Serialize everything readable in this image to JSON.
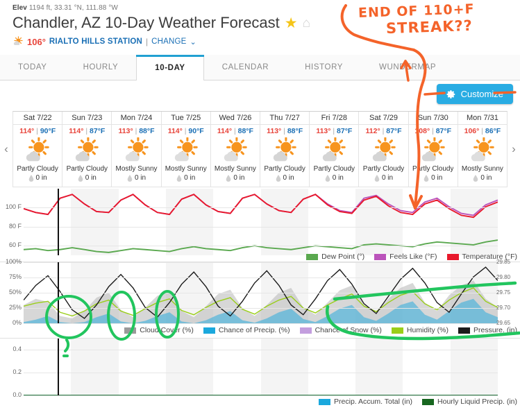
{
  "header": {
    "elev_prefix": "Elev",
    "elev_value": "1194 ft, 33.31 °N, 111.88 °W",
    "title": "Chandler, AZ 10-Day Weather Forecast",
    "star_icon": "star-icon",
    "home_icon": "home-icon",
    "current_temp": "106°",
    "station": "RIALTO HILLS STATION",
    "pipe": "|",
    "change_label": "CHANGE",
    "chevron": "chevron-down-icon"
  },
  "tabs": [
    {
      "label": "TODAY",
      "active": false
    },
    {
      "label": "HOURLY",
      "active": false
    },
    {
      "label": "10-DAY",
      "active": true
    },
    {
      "label": "CALENDAR",
      "active": false
    },
    {
      "label": "HISTORY",
      "active": false
    },
    {
      "label": "WUNDERMAP",
      "active": false
    }
  ],
  "customize": {
    "label": "Customize",
    "icon": "gear-icon",
    "color": "#29ace3"
  },
  "nav": {
    "prev": "‹",
    "next": "›"
  },
  "days": [
    {
      "name": "Sat 7/22",
      "high": "114°",
      "low": "90°F",
      "cond": "Partly Cloudy",
      "precip": "0 in",
      "icon": "partly-cloudy-icon"
    },
    {
      "name": "Sun 7/23",
      "high": "114°",
      "low": "87°F",
      "cond": "Partly Cloudy",
      "precip": "0 in",
      "icon": "partly-cloudy-icon"
    },
    {
      "name": "Mon 7/24",
      "high": "113°",
      "low": "88°F",
      "cond": "Mostly Sunny",
      "precip": "0 in",
      "icon": "mostly-sunny-icon"
    },
    {
      "name": "Tue 7/25",
      "high": "114°",
      "low": "90°F",
      "cond": "Mostly Sunny",
      "precip": "0 in",
      "icon": "mostly-sunny-icon"
    },
    {
      "name": "Wed 7/26",
      "high": "114°",
      "low": "88°F",
      "cond": "Mostly Sunny",
      "precip": "0 in",
      "icon": "mostly-sunny-icon"
    },
    {
      "name": "Thu 7/27",
      "high": "113°",
      "low": "88°F",
      "cond": "Partly Cloudy",
      "precip": "0 in",
      "icon": "partly-cloudy-icon"
    },
    {
      "name": "Fri 7/28",
      "high": "113°",
      "low": "87°F",
      "cond": "Partly Cloudy",
      "precip": "0 in",
      "icon": "partly-cloudy-icon"
    },
    {
      "name": "Sat 7/29",
      "high": "112°",
      "low": "87°F",
      "cond": "Partly Cloudy",
      "precip": "0 in",
      "icon": "partly-cloudy-icon"
    },
    {
      "name": "Sun 7/30",
      "high": "108°",
      "low": "87°F",
      "cond": "Partly Cloudy",
      "precip": "0 in",
      "icon": "partly-cloudy-icon"
    },
    {
      "name": "Mon 7/31",
      "high": "106°",
      "low": "86°F",
      "cond": "Mostly Sunny",
      "precip": "0 in",
      "icon": "mostly-sunny-icon"
    }
  ],
  "annotations": {
    "orange_line1": "END OF 110+F",
    "orange_line2": "STREAK??",
    "orange_color": "#f4632a",
    "green_color": "#22c55e",
    "green_question": "?"
  },
  "chart_data": [
    {
      "type": "line",
      "title": "Temperature / Feels Like / Dew Point",
      "xlabel": "",
      "ylabel": "",
      "ylim": [
        50,
        120
      ],
      "yticks": [
        "60 F",
        "80 F",
        "100 F"
      ],
      "ytick_values": [
        60,
        80,
        100
      ],
      "grid": true,
      "legend_position": "bottom-right",
      "categories": [
        "Sat 7/22",
        "Sun 7/23",
        "Mon 7/24",
        "Tue 7/25",
        "Wed 7/26",
        "Thu 7/27",
        "Fri 7/28",
        "Sat 7/29",
        "Sun 7/30",
        "Mon 7/31"
      ],
      "series": [
        {
          "name": "Temperature (°F)",
          "color": "#e8192c",
          "values": [
            99,
            95,
            93,
            110,
            114,
            104,
            96,
            95,
            108,
            114,
            103,
            95,
            93,
            109,
            114,
            103,
            96,
            94,
            110,
            114,
            104,
            97,
            95,
            109,
            114,
            103,
            96,
            94,
            108,
            112,
            102,
            95,
            93,
            104,
            108,
            99,
            92,
            90,
            101,
            106
          ]
        },
        {
          "name": "Feels Like (°F)",
          "color": "#bb54bb",
          "values": [
            99,
            95,
            93,
            110,
            114,
            104,
            96,
            95,
            108,
            114,
            103,
            95,
            93,
            109,
            114,
            103,
            96,
            94,
            110,
            114,
            104,
            97,
            95,
            109,
            114,
            104,
            97,
            95,
            110,
            113,
            104,
            97,
            95,
            106,
            110,
            101,
            94,
            92,
            103,
            108
          ]
        },
        {
          "name": "Dew Point (°)",
          "color": "#5aa84f",
          "values": [
            56,
            57,
            55,
            56,
            58,
            56,
            54,
            53,
            55,
            57,
            56,
            55,
            54,
            57,
            59,
            57,
            56,
            55,
            58,
            60,
            58,
            57,
            56,
            58,
            60,
            59,
            58,
            57,
            61,
            62,
            61,
            60,
            59,
            62,
            64,
            63,
            62,
            61,
            64,
            66
          ]
        }
      ]
    },
    {
      "type": "line",
      "title": "Cloud Cover / Precip / Humidity / Pressure",
      "ylim": [
        0,
        100
      ],
      "yticks": [
        "0%",
        "25%",
        "50%",
        "75%",
        "100%"
      ],
      "ytick_values": [
        0,
        25,
        50,
        75,
        100
      ],
      "y2ticks": [
        "29.65",
        "29.70",
        "29.75",
        "29.80",
        "29.85"
      ],
      "y2lim": [
        29.62,
        29.88
      ],
      "grid": true,
      "legend_position": "bottom-right",
      "categories": [
        "Sat 7/22",
        "Sun 7/23",
        "Mon 7/24",
        "Tue 7/25",
        "Wed 7/26",
        "Thu 7/27",
        "Fri 7/28",
        "Sat 7/29",
        "Sun 7/30",
        "Mon 7/31"
      ],
      "series": [
        {
          "name": "Cloud Cover (%)",
          "color": "#b0b0b0",
          "values": [
            30,
            40,
            35,
            12,
            8,
            20,
            42,
            50,
            22,
            10,
            26,
            45,
            52,
            20,
            10,
            28,
            48,
            55,
            25,
            12,
            30,
            50,
            58,
            26,
            14,
            34,
            54,
            62,
            30,
            16,
            40,
            58,
            66,
            34,
            20,
            46,
            62,
            70,
            40,
            26
          ]
        },
        {
          "name": "Chance of Precip. (%)",
          "color": "#1ba8dd",
          "values": [
            2,
            6,
            12,
            2,
            0,
            2,
            10,
            16,
            3,
            0,
            4,
            12,
            18,
            3,
            0,
            5,
            14,
            20,
            5,
            1,
            8,
            18,
            24,
            7,
            2,
            12,
            24,
            30,
            10,
            4,
            16,
            30,
            36,
            14,
            6,
            20,
            34,
            40,
            18,
            10
          ]
        },
        {
          "name": "Chance of Snow (%)",
          "color": "#c39ede",
          "values": [
            0,
            0,
            0,
            0,
            0,
            0,
            0,
            0,
            0,
            0,
            0,
            0,
            0,
            0,
            0,
            0,
            0,
            0,
            0,
            0,
            0,
            0,
            0,
            0,
            0,
            0,
            0,
            0,
            0,
            0,
            0,
            0,
            0,
            0,
            0,
            0,
            0,
            0,
            0,
            0
          ]
        },
        {
          "name": "Humidity (%)",
          "color": "#9ace19",
          "values": [
            28,
            33,
            36,
            18,
            12,
            20,
            32,
            38,
            20,
            13,
            24,
            34,
            40,
            21,
            14,
            26,
            36,
            42,
            23,
            15,
            28,
            38,
            44,
            25,
            17,
            30,
            40,
            48,
            28,
            19,
            34,
            46,
            52,
            32,
            22,
            38,
            50,
            58,
            36,
            26
          ]
        },
        {
          "name": "Pressure. (in)",
          "color": "#1b1b1b",
          "values": [
            38,
            62,
            78,
            52,
            22,
            8,
            30,
            60,
            80,
            58,
            26,
            10,
            34,
            64,
            84,
            60,
            28,
            12,
            36,
            66,
            86,
            62,
            30,
            14,
            40,
            70,
            88,
            64,
            32,
            16,
            44,
            72,
            90,
            66,
            34,
            18,
            48,
            76,
            92,
            70
          ]
        }
      ]
    },
    {
      "type": "area",
      "title": "Precipitation Accumulation",
      "ylim": [
        0,
        0.5
      ],
      "yticks": [
        "0.0",
        "0.2",
        "0.4"
      ],
      "ytick_values": [
        0.0,
        0.2,
        0.4
      ],
      "grid": true,
      "legend_position": "bottom-right",
      "categories": [
        "Sat 7/22",
        "Sun 7/23",
        "Mon 7/24",
        "Tue 7/25",
        "Wed 7/26",
        "Thu 7/27",
        "Fri 7/28",
        "Sat 7/29",
        "Sun 7/30",
        "Mon 7/31"
      ],
      "series": [
        {
          "name": "Precip. Accum. Total (in)",
          "color": "#1ba8dd",
          "values": [
            0,
            0,
            0,
            0,
            0,
            0,
            0,
            0,
            0,
            0,
            0,
            0,
            0,
            0,
            0,
            0,
            0,
            0,
            0,
            0,
            0,
            0,
            0,
            0,
            0,
            0,
            0,
            0,
            0,
            0,
            0,
            0,
            0,
            0,
            0,
            0,
            0,
            0,
            0,
            0
          ]
        },
        {
          "name": "Hourly Liquid Precip. (in)",
          "color": "#17661f",
          "values": [
            0,
            0,
            0,
            0,
            0,
            0,
            0,
            0,
            0,
            0,
            0,
            0,
            0,
            0,
            0,
            0,
            0,
            0,
            0,
            0,
            0,
            0,
            0,
            0,
            0,
            0,
            0,
            0,
            0,
            0,
            0,
            0,
            0,
            0,
            0,
            0,
            0,
            0,
            0,
            0
          ]
        }
      ]
    }
  ]
}
